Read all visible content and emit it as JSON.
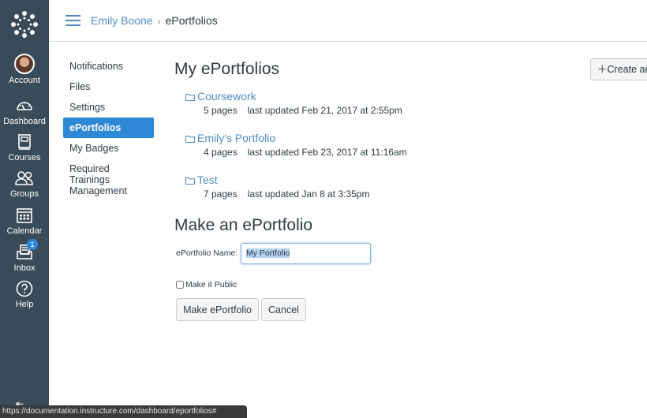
{
  "global_nav": {
    "items": [
      {
        "label": "Account",
        "icon": "avatar"
      },
      {
        "label": "Dashboard",
        "icon": "dashboard-icon"
      },
      {
        "label": "Courses",
        "icon": "courses-icon"
      },
      {
        "label": "Groups",
        "icon": "groups-icon"
      },
      {
        "label": "Calendar",
        "icon": "calendar-icon"
      },
      {
        "label": "Inbox",
        "icon": "inbox-icon",
        "badge": "1"
      },
      {
        "label": "Help",
        "icon": "help-icon"
      }
    ]
  },
  "header": {
    "breadcrumb": {
      "parent": "Emily Boone",
      "separator": "›",
      "current": "ePortfolios"
    }
  },
  "subnav": {
    "items": [
      {
        "label": "Notifications",
        "active": false
      },
      {
        "label": "Files",
        "active": false
      },
      {
        "label": "Settings",
        "active": false
      },
      {
        "label": "ePortfolios",
        "active": true
      },
      {
        "label": "My Badges",
        "active": false
      },
      {
        "label": "Required Trainings Management",
        "active": false
      }
    ]
  },
  "main": {
    "title": "My ePortfolios",
    "create_button": "Create an",
    "portfolios": [
      {
        "name": "Coursework",
        "pages": "5 pages",
        "updated": "last updated Feb 21, 2017 at 2:55pm"
      },
      {
        "name": "Emily's Portfolio",
        "pages": "4 pages",
        "updated": "last updated Feb 23, 2017 at 11:16am"
      },
      {
        "name": "Test",
        "pages": "7 pages",
        "updated": "last updated Jan 8 at 3:35pm"
      }
    ]
  },
  "make_form": {
    "title": "Make an ePortfolio",
    "name_label": "ePortfolio Name:",
    "name_value": "My Portfolio",
    "public_label": "Make it Public",
    "public_checked": false,
    "submit_label": "Make ePortfolio",
    "cancel_label": "Cancel"
  },
  "status_bar": {
    "url": "https://documentation.instructure.com/dashboard/eportfolios#"
  },
  "colors": {
    "nav_bg": "#394b58",
    "link": "#4f8dc4",
    "active": "#2f88d6"
  }
}
